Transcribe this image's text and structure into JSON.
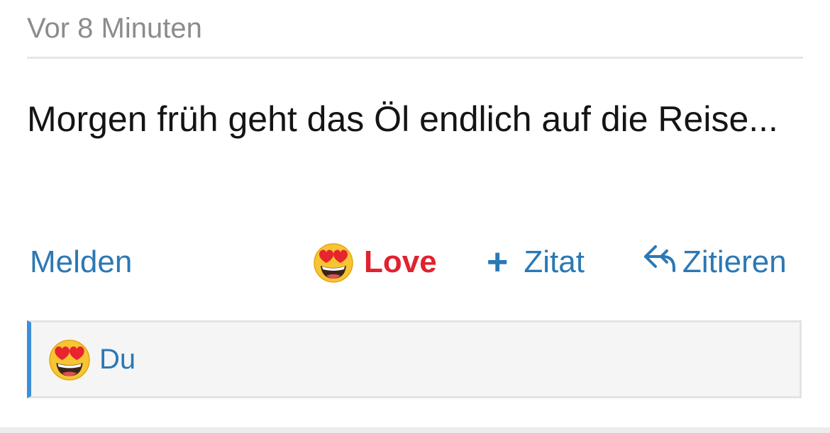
{
  "post": {
    "timestamp": "Vor 8 Minuten",
    "message": "Morgen früh geht das Öl endlich auf die Reise..."
  },
  "actions": {
    "report_label": "Melden",
    "love_label": "Love",
    "quote_add_label": "Zitat",
    "quote_add_symbol": "+",
    "quote_label": "Zitieren"
  },
  "reactions": {
    "users_label": "Du",
    "emoji": "heart-eyes-emoji"
  },
  "colors": {
    "link": "#2b78b5",
    "love": "#e0222f",
    "accent_border": "#3d8fd6",
    "timestamp": "#8c8c8c"
  }
}
